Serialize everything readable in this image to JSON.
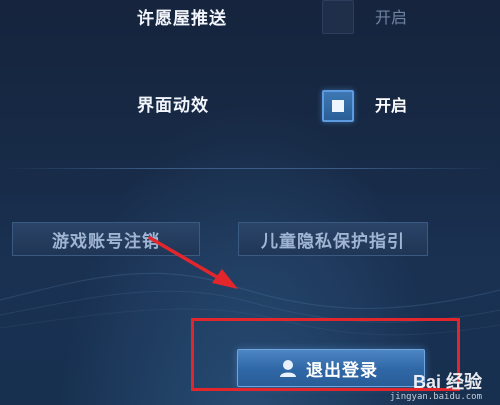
{
  "settings": {
    "wish_push": {
      "label": "许愿屋推送",
      "state_text": "开启",
      "checked": false
    },
    "ui_animation": {
      "label": "界面动效",
      "state_text": "开启",
      "checked": true
    }
  },
  "actions": {
    "cancel_account": "游戏账号注销",
    "child_privacy": "儿童隐私保护指引",
    "logout": "退出登录"
  },
  "watermark": {
    "brand": "Bai 经验",
    "url": "jingyan.baidu.com"
  },
  "colors": {
    "background": "#172a46",
    "checkbox_active": "#3d78b4",
    "annotation": "#e2262b",
    "logout_button": "#3d77b5"
  }
}
